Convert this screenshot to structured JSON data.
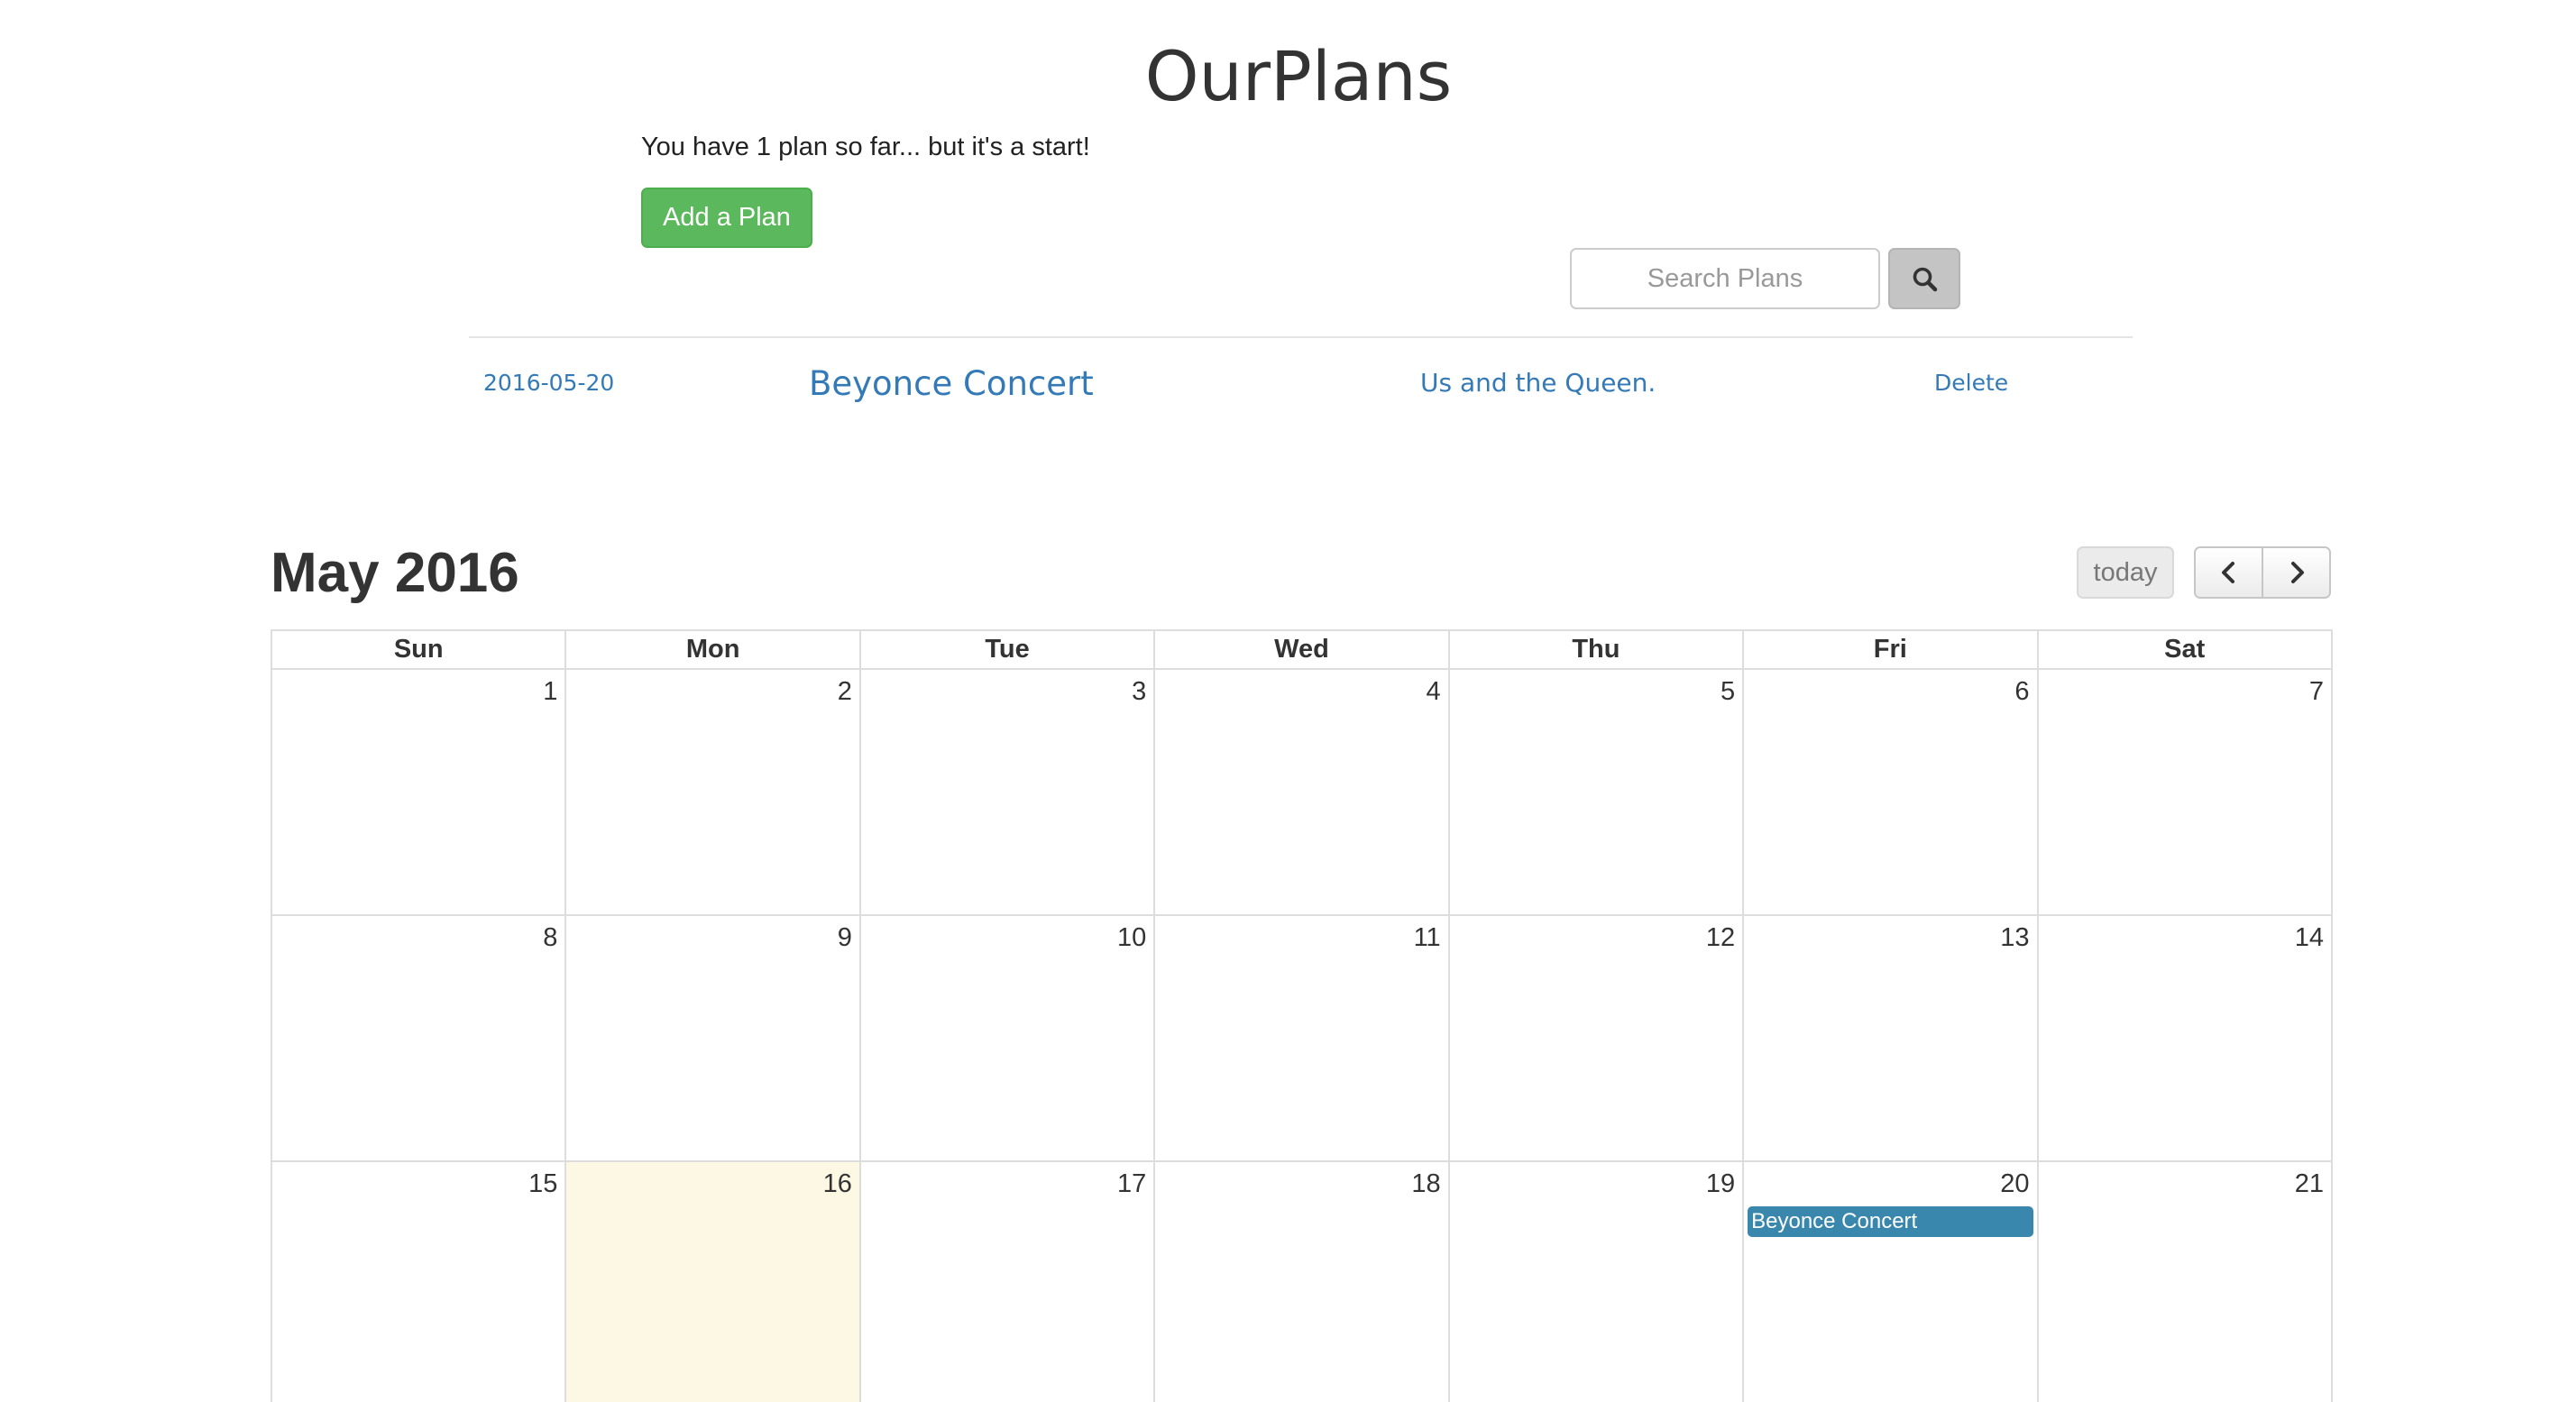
{
  "app": {
    "title": "OurPlans",
    "plan_count_text": "You have 1 plan so far... but it's a start!",
    "add_plan_label": "Add a Plan"
  },
  "search": {
    "placeholder": "Search Plans",
    "button_icon": "search-icon"
  },
  "plans": [
    {
      "date": "2016-05-20",
      "title": "Beyonce Concert",
      "description": "Us and the Queen.",
      "delete_label": "Delete"
    }
  ],
  "calendar": {
    "title": "May 2016",
    "today_label": "today",
    "prev_icon": "chevron-left-icon",
    "next_icon": "chevron-right-icon",
    "weekdays": [
      "Sun",
      "Mon",
      "Tue",
      "Wed",
      "Thu",
      "Fri",
      "Sat"
    ],
    "weeks": [
      [
        "1",
        "2",
        "3",
        "4",
        "5",
        "6",
        "7"
      ],
      [
        "8",
        "9",
        "10",
        "11",
        "12",
        "13",
        "14"
      ],
      [
        "15",
        "16",
        "17",
        "18",
        "19",
        "20",
        "21"
      ]
    ],
    "today_day": "16",
    "events": [
      {
        "day": "20",
        "title": "Beyonce Concert"
      }
    ],
    "colors": {
      "event": "#3a87ad",
      "today_highlight": "#fcf8e3",
      "add_button": "#5cb85c",
      "link": "#337ab7"
    }
  }
}
